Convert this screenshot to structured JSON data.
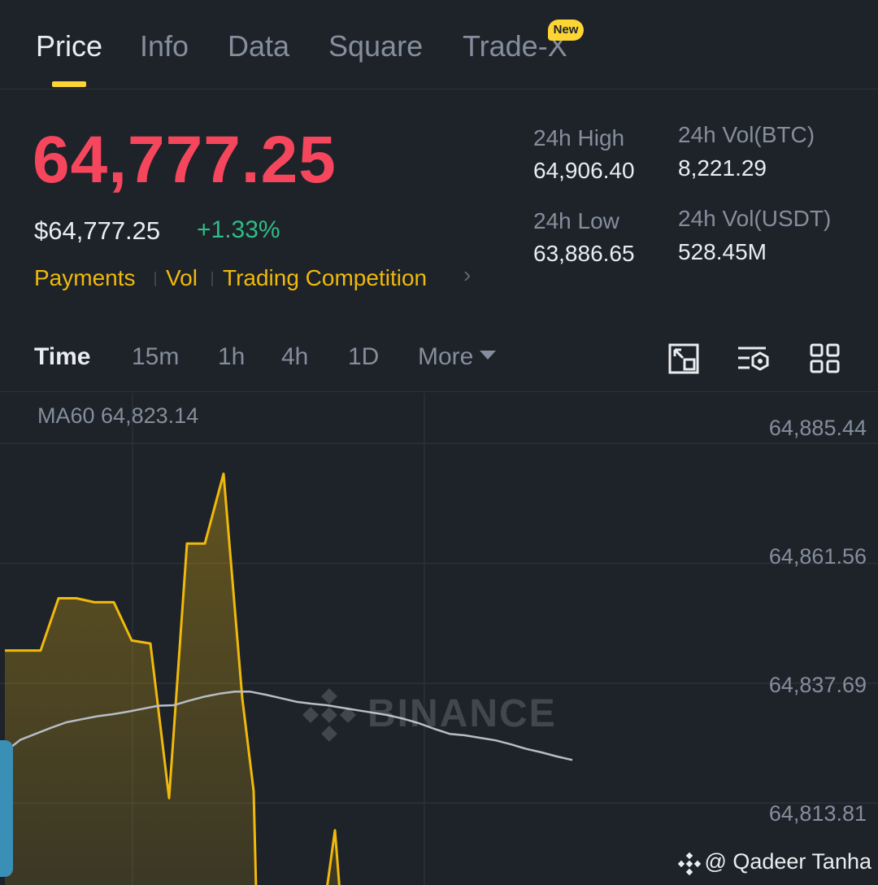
{
  "tabs": [
    {
      "label": "Price",
      "active": true
    },
    {
      "label": "Info"
    },
    {
      "label": "Data"
    },
    {
      "label": "Square"
    },
    {
      "label": "Trade-X",
      "badge": "New"
    }
  ],
  "header": {
    "last_price": "64,777.25",
    "usd_price": "$64,777.25",
    "change_pct": "+1.33%",
    "tags": [
      "Payments",
      "Vol",
      "Trading Competition"
    ],
    "stats": {
      "high_label": "24h High",
      "high_value": "64,906.40",
      "low_label": "24h Low",
      "low_value": "63,886.65",
      "vol_btc_label": "24h Vol(BTC)",
      "vol_btc_value": "8,221.29",
      "vol_usdt_label": "24h Vol(USDT)",
      "vol_usdt_value": "528.45M"
    }
  },
  "intervals": {
    "items": [
      "Time",
      "15m",
      "1h",
      "4h",
      "1D",
      "More"
    ],
    "active": "Time",
    "tools": [
      "fullscreen-icon",
      "indicator-settings-icon",
      "grid-layout-icon"
    ]
  },
  "chart": {
    "ma_label": "MA60 64,823.14",
    "watermark": "BINANCE",
    "credit": "@ Qadeer Tanha"
  },
  "colors": {
    "background": "#1e2329",
    "up": "#2ebd85",
    "down": "#f6465d",
    "accent": "#fcd535",
    "price_line": "#f0b90b",
    "ma_line": "#b7bdc6"
  },
  "chart_data": {
    "type": "area",
    "title": "",
    "xlabel": "",
    "ylabel": "",
    "y_ticks": [
      "64,885.44",
      "64,861.56",
      "64,837.69",
      "64,813.81"
    ],
    "ylim": [
      64797.5,
      64895.5
    ],
    "series": [
      {
        "name": "",
        "style": "area",
        "x": [
          0,
          1,
          2,
          3,
          4,
          5,
          6,
          7,
          8,
          9,
          10,
          11,
          12,
          13,
          14,
          15,
          16,
          17,
          18,
          19,
          20,
          21,
          22,
          23
        ],
        "values": [
          64844.2,
          64844.2,
          64844.2,
          64854.6,
          64854.6,
          64853.8,
          64853.8,
          64846.2,
          64845.6,
          64814.8,
          64865.5,
          64865.5,
          64879.4,
          64834.7,
          64816.2,
          64790.0,
          64790.0,
          64790.0,
          64790.0,
          64790.0,
          64790.0,
          64799.0,
          64808.4,
          64792.0
        ]
      },
      {
        "name": "MA60",
        "style": "line",
        "x": [
          0,
          1,
          2,
          3,
          4,
          5,
          6,
          7,
          8,
          9,
          10,
          11,
          12,
          13,
          14,
          15,
          16,
          17,
          18,
          19,
          20,
          21,
          22,
          23,
          24,
          25,
          26,
          27,
          28,
          29,
          30,
          31,
          32,
          33,
          34,
          35,
          36,
          37
        ],
        "values": [
          64824.0,
          64826.4,
          64827.6,
          64828.8,
          64829.9,
          64830.5,
          64831.1,
          64831.5,
          64832.0,
          64832.6,
          64833.2,
          64833.3,
          64834.2,
          64835.0,
          64835.6,
          64836.0,
          64836.0,
          64835.4,
          64834.7,
          64834.0,
          64833.6,
          64833.3,
          64832.8,
          64832.3,
          64831.8,
          64831.3,
          64830.6,
          64829.7,
          64828.6,
          64827.6,
          64827.3,
          64826.8,
          64826.3,
          64825.5,
          64824.6,
          64823.9,
          64823.1,
          64822.4
        ]
      }
    ],
    "grid": true,
    "legend": "none"
  }
}
